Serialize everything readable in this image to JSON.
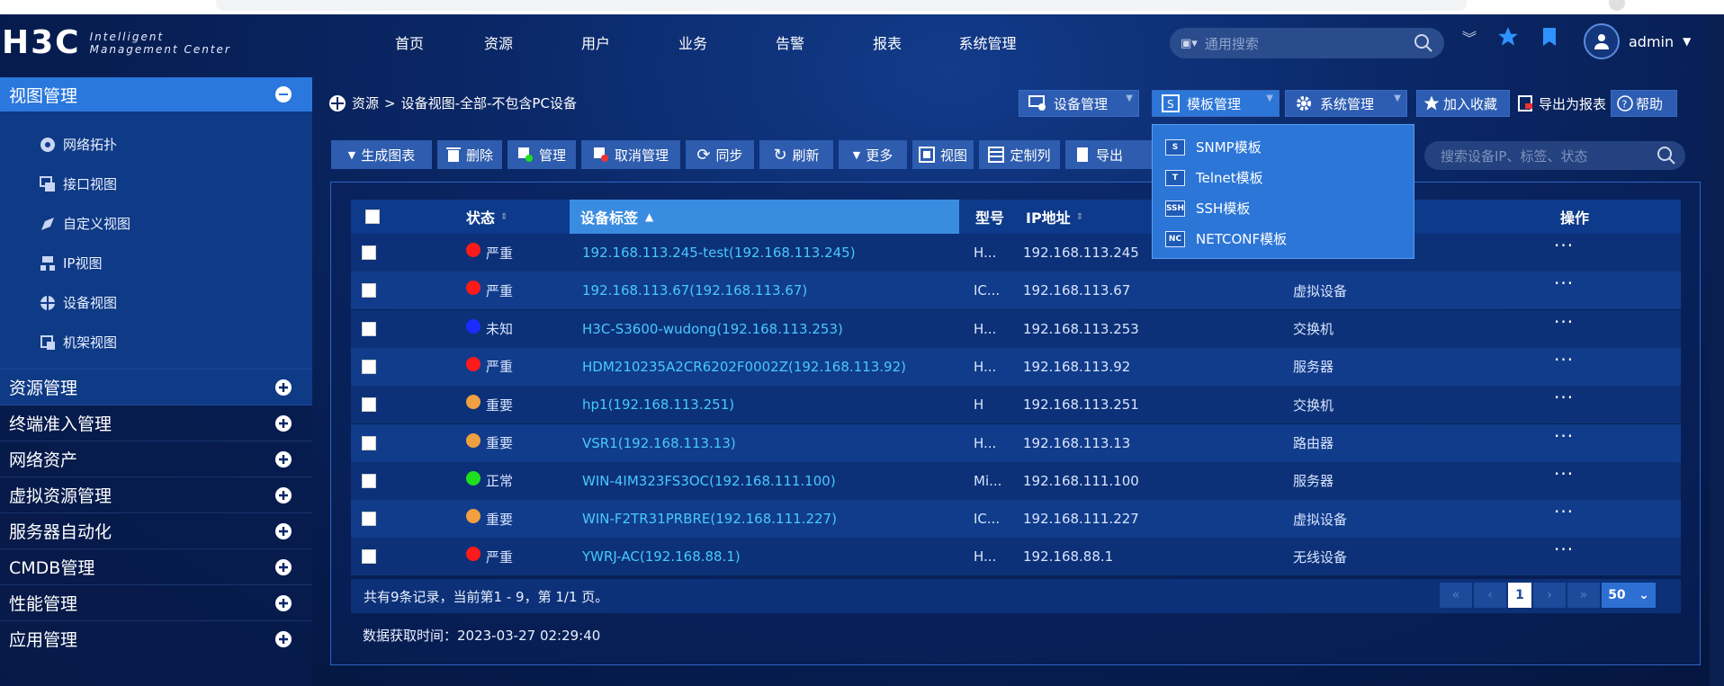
{
  "header": {
    "logo_main": "H3C",
    "logo_sub_1": "Intelligent",
    "logo_sub_2": "Management Center",
    "nav": [
      "首页",
      "资源",
      "用户",
      "业务",
      "告警",
      "报表",
      "系统管理"
    ],
    "search_placeholder": "通用搜索",
    "user": "admin"
  },
  "sidebar": {
    "active_group": "视图管理",
    "sub_items": [
      {
        "label": "网络拓扑",
        "icon": "topology-icon"
      },
      {
        "label": "接口视图",
        "icon": "interface-icon"
      },
      {
        "label": "自定义视图",
        "icon": "custom-view-icon"
      },
      {
        "label": "IP视图",
        "icon": "ip-view-icon"
      },
      {
        "label": "设备视图",
        "icon": "device-view-icon"
      },
      {
        "label": "机架视图",
        "icon": "rack-view-icon"
      }
    ],
    "groups": [
      "资源管理",
      "终端准入管理",
      "网络资产",
      "虚拟资源管理",
      "服务器自动化",
      "CMDB管理",
      "性能管理",
      "应用管理"
    ]
  },
  "breadcrumb": {
    "root": "资源",
    "sep": ">",
    "current": "设备视图-全部-不包含PC设备"
  },
  "topbar": {
    "device_mgmt": "设备管理",
    "template_mgmt": "模板管理",
    "system_mgmt": "系统管理",
    "favorite": "加入收藏",
    "export": "导出为报表",
    "help": "帮助"
  },
  "toolbar": {
    "generate": "生成图表",
    "delete": "删除",
    "manage": "管理",
    "unmanage": "取消管理",
    "sync": "同步",
    "refresh": "刷新",
    "more": "更多",
    "view": "视图",
    "custom_columns": "定制列",
    "export": "导出",
    "search_placeholder": "搜索设备IP、标签、状态"
  },
  "template_menu": [
    {
      "label": "SNMP模板",
      "icon": "S"
    },
    {
      "label": "Telnet模板",
      "icon": "T"
    },
    {
      "label": "SSH模板",
      "icon": "SSH"
    },
    {
      "label": "NETCONF模板",
      "icon": "NC"
    }
  ],
  "table": {
    "headers": {
      "status": "状态",
      "label": "设备标签",
      "model": "型号",
      "ip": "IP地址",
      "ops": "操作"
    },
    "rows": [
      {
        "status": "严重",
        "color": "#ff1a1a",
        "label": "192.168.113.245-test(192.168.113.245)",
        "model": "H...",
        "ip": "192.168.113.245",
        "type": "",
        "ops": "···"
      },
      {
        "status": "严重",
        "color": "#ff1a1a",
        "label": "192.168.113.67(192.168.113.67)",
        "model": "IC...",
        "ip": "192.168.113.67",
        "type": "虚拟设备",
        "ops": "···"
      },
      {
        "status": "未知",
        "color": "#1a2cff",
        "label": "H3C-S3600-wudong(192.168.113.253)",
        "model": "H...",
        "ip": "192.168.113.253",
        "type": "交换机",
        "ops": "···"
      },
      {
        "status": "严重",
        "color": "#ff1a1a",
        "label": "HDM210235A2CR6202F0002Z(192.168.113.92)",
        "model": "H...",
        "ip": "192.168.113.92",
        "type": "服务器",
        "ops": "···"
      },
      {
        "status": "重要",
        "color": "#f0a040",
        "label": "hp1(192.168.113.251)",
        "model": "H",
        "ip": "192.168.113.251",
        "type": "交换机",
        "ops": "···"
      },
      {
        "status": "重要",
        "color": "#f0a040",
        "label": "VSR1(192.168.113.13)",
        "model": "H...",
        "ip": "192.168.113.13",
        "type": "路由器",
        "ops": "···"
      },
      {
        "status": "正常",
        "color": "#1ee01e",
        "label": "WIN-4IM323FS3OC(192.168.111.100)",
        "model": "Mi...",
        "ip": "192.168.111.100",
        "type": "服务器",
        "ops": "···"
      },
      {
        "status": "重要",
        "color": "#f0a040",
        "label": "WIN-F2TR31PRBRE(192.168.111.227)",
        "model": "IC...",
        "ip": "192.168.111.227",
        "type": "虚拟设备",
        "ops": "···"
      },
      {
        "status": "严重",
        "color": "#ff1a1a",
        "label": "YWRJ-AC(192.168.88.1)",
        "model": "H...",
        "ip": "192.168.88.1",
        "type": "无线设备",
        "ops": "···"
      }
    ]
  },
  "footer": {
    "summary": "共有9条记录，当前第1 - 9，第 1/1 页。",
    "page": "1",
    "page_size": "50",
    "fetch_time": "数据获取时间：2023-03-27 02:29:40"
  },
  "colors": {
    "accent": "#2a78dd",
    "panel": "#0c3178",
    "link": "#48c8ff"
  }
}
